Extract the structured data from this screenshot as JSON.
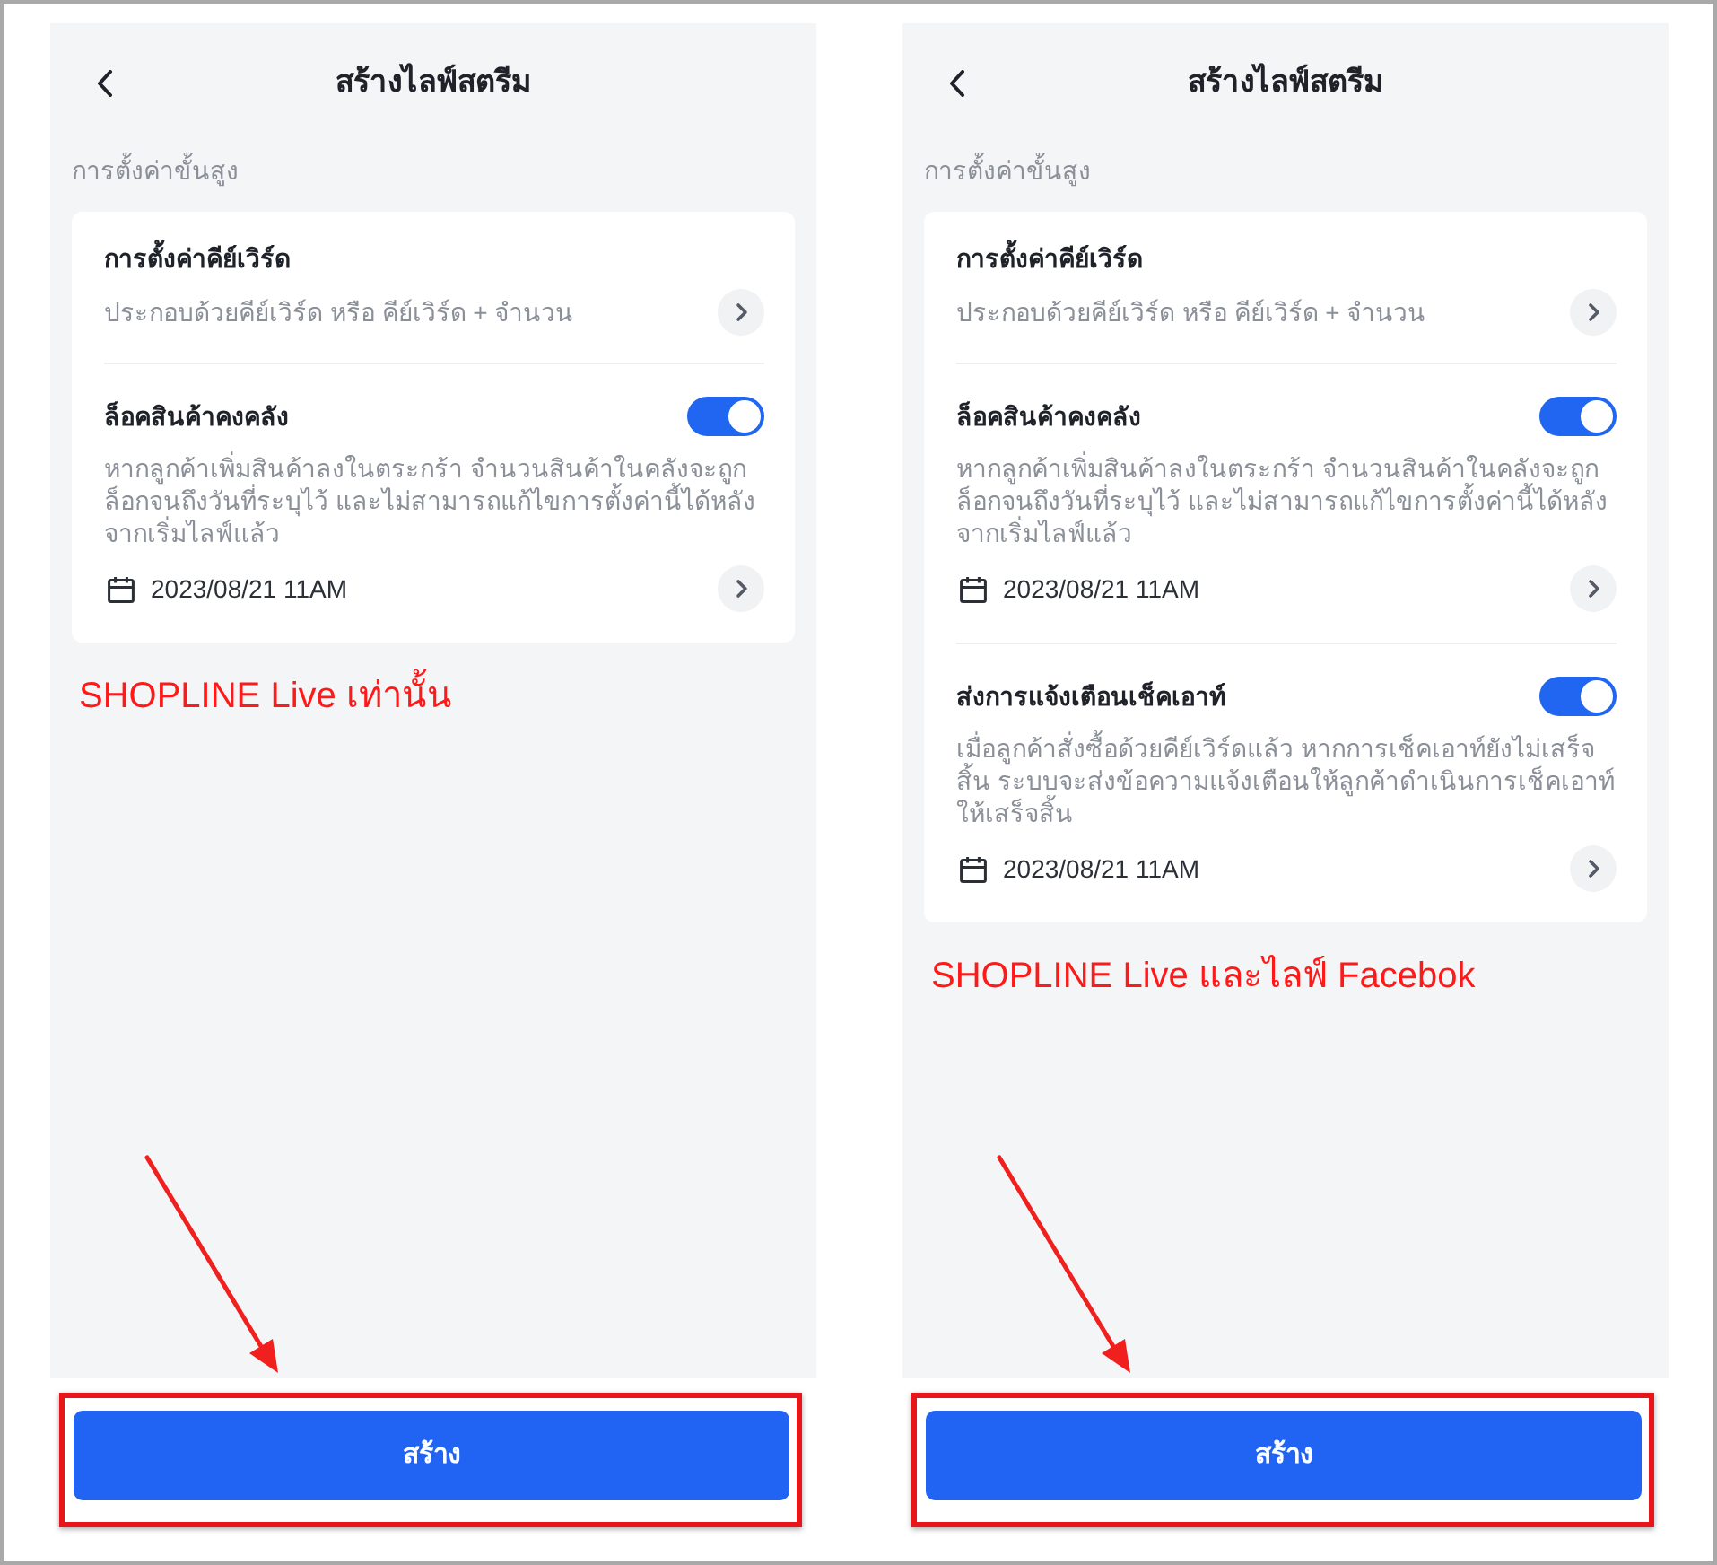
{
  "panels": [
    {
      "title": "สร้างไลฟ์สตรีม",
      "section_label": "การตั้งค่าขั้นสูง",
      "settings": [
        {
          "kind": "link",
          "title": "การตั้งค่าคีย์เวิร์ด",
          "subtitle": "ประกอบด้วยคีย์เวิร์ด หรือ คีย์เวิร์ด + จำนวน"
        },
        {
          "kind": "toggle",
          "title": "ล็อคสินค้าคงคลัง",
          "on": true,
          "description": "หากลูกค้าเพิ่มสินค้าลงในตระกร้า จำนวนสินค้าในคลังจะถูกล็อกจนถึงวันที่ระบุไว้ และไม่สามารถแก้ไขการตั้งค่านี้ได้หลังจากเริ่มไลฟ์แล้ว",
          "date": "2023/08/21 11AM"
        }
      ],
      "annotation": "SHOPLINE Live เท่านั้น",
      "create_button": {
        "label": "สร้าง",
        "highlighted": true
      }
    },
    {
      "title": "สร้างไลฟ์สตรีม",
      "section_label": "การตั้งค่าขั้นสูง",
      "settings": [
        {
          "kind": "link",
          "title": "การตั้งค่าคีย์เวิร์ด",
          "subtitle": "ประกอบด้วยคีย์เวิร์ด หรือ คีย์เวิร์ด + จำนวน"
        },
        {
          "kind": "toggle",
          "title": "ล็อคสินค้าคงคลัง",
          "on": true,
          "description": "หากลูกค้าเพิ่มสินค้าลงในตระกร้า จำนวนสินค้าในคลังจะถูกล็อกจนถึงวันที่ระบุไว้ และไม่สามารถแก้ไขการตั้งค่านี้ได้หลังจากเริ่มไลฟ์แล้ว",
          "date": "2023/08/21 11AM"
        },
        {
          "kind": "toggle",
          "title": "ส่งการแจ้งเตือนเช็คเอาท์",
          "on": true,
          "description": "เมื่อลูกค้าสั่งซื้อด้วยคีย์เวิร์ดแล้ว หากการเช็คเอาท์ยังไม่เสร็จสิ้น ระบบจะส่งข้อความแจ้งเตือนให้ลูกค้าดำเนินการเช็คเอาท์ให้เสร็จสิ้น",
          "date": "2023/08/21 11AM"
        }
      ],
      "annotation": "SHOPLINE Live และไลฟ์ Facebok",
      "create_button": {
        "label": "สร้าง",
        "highlighted": true
      }
    }
  ]
}
